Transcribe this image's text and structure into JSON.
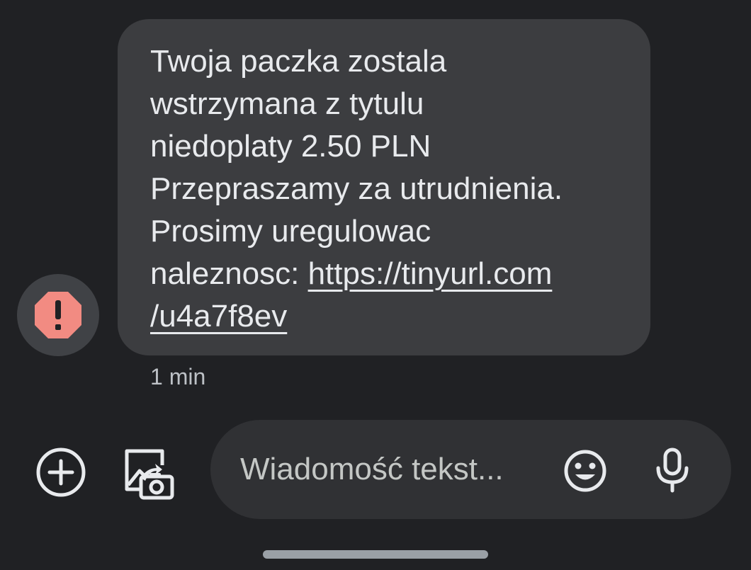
{
  "message": {
    "sender_icon": "alert-octagon-icon",
    "sender_icon_color": "#f28b82",
    "lines": [
      "Twoja paczka zostala",
      "wstrzymana z tytulu",
      "niedoplaty 2.50 PLN",
      "Przepraszamy za utrudnienia.",
      "Prosimy uregulowac"
    ],
    "link_prefix": "naleznosc: ",
    "link_part1": "https://tinyurl.com",
    "link_part2": "/u4a7f8ev",
    "timestamp": "1 min"
  },
  "composer": {
    "add_icon": "add-circle-icon",
    "gallery_icon": "gallery-icon",
    "placeholder": "Wiadomość tekst...",
    "emoji_icon": "emoji-icon",
    "mic_icon": "microphone-icon"
  },
  "colors": {
    "background": "#202124",
    "bubble": "#3c3d40",
    "compose_field": "#303134",
    "text": "#e8eaed",
    "muted_text": "#bdc1c6"
  }
}
